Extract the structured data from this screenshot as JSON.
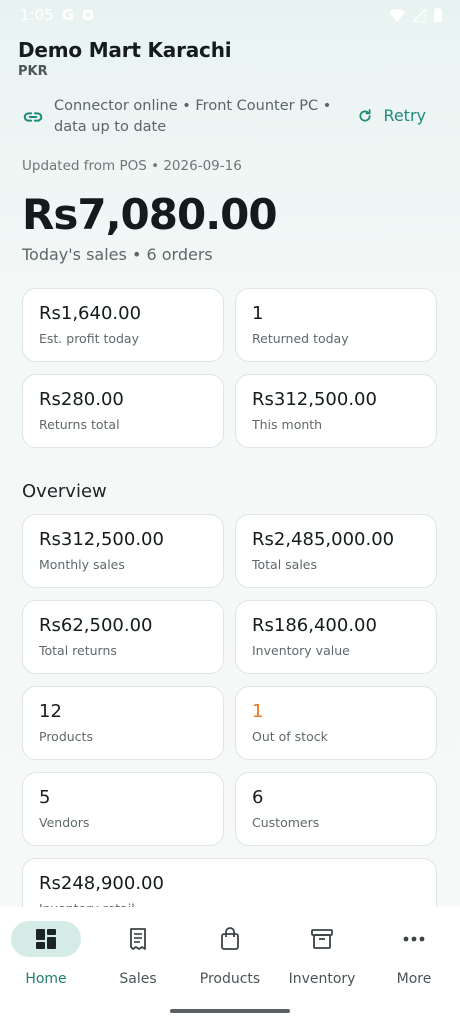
{
  "status_bar": {
    "time": "1:05",
    "g": "G"
  },
  "header": {
    "store_name": "Demo Mart Karachi",
    "currency": "PKR"
  },
  "connector": {
    "status_text": "Connector online • Front Counter PC • data up to date",
    "retry_label": "Retry"
  },
  "updated": "Updated from POS • 2026-09-16",
  "today": {
    "sales": "Rs7,080.00",
    "summary": "Today's sales • 6 orders"
  },
  "today_cards": [
    {
      "value": "Rs1,640.00",
      "label": "Est. profit today"
    },
    {
      "value": "1",
      "label": "Returned today"
    },
    {
      "value": "Rs280.00",
      "label": "Returns total"
    },
    {
      "value": "Rs312,500.00",
      "label": "This month"
    }
  ],
  "overview": {
    "title": "Overview",
    "cards": [
      {
        "value": "Rs312,500.00",
        "label": "Monthly sales"
      },
      {
        "value": "Rs2,485,000.00",
        "label": "Total sales"
      },
      {
        "value": "Rs62,500.00",
        "label": "Total returns"
      },
      {
        "value": "Rs186,400.00",
        "label": "Inventory value"
      },
      {
        "value": "12",
        "label": "Products"
      },
      {
        "value": "1",
        "label": "Out of stock"
      },
      {
        "value": "5",
        "label": "Vendors"
      },
      {
        "value": "6",
        "label": "Customers"
      },
      {
        "value": "Rs248,900.00",
        "label": "Inventory retail"
      }
    ]
  },
  "nav": {
    "items": [
      {
        "label": "Home",
        "icon": "dashboard-icon"
      },
      {
        "label": "Sales",
        "icon": "receipt-icon"
      },
      {
        "label": "Products",
        "icon": "shopping-bag-icon"
      },
      {
        "label": "Inventory",
        "icon": "archive-box-icon"
      },
      {
        "label": "More",
        "icon": "more-dots-icon"
      }
    ]
  },
  "colors": {
    "accent": "#1e8a7a",
    "alert": "#e8761e",
    "active_pill": "#d4ebe6"
  }
}
